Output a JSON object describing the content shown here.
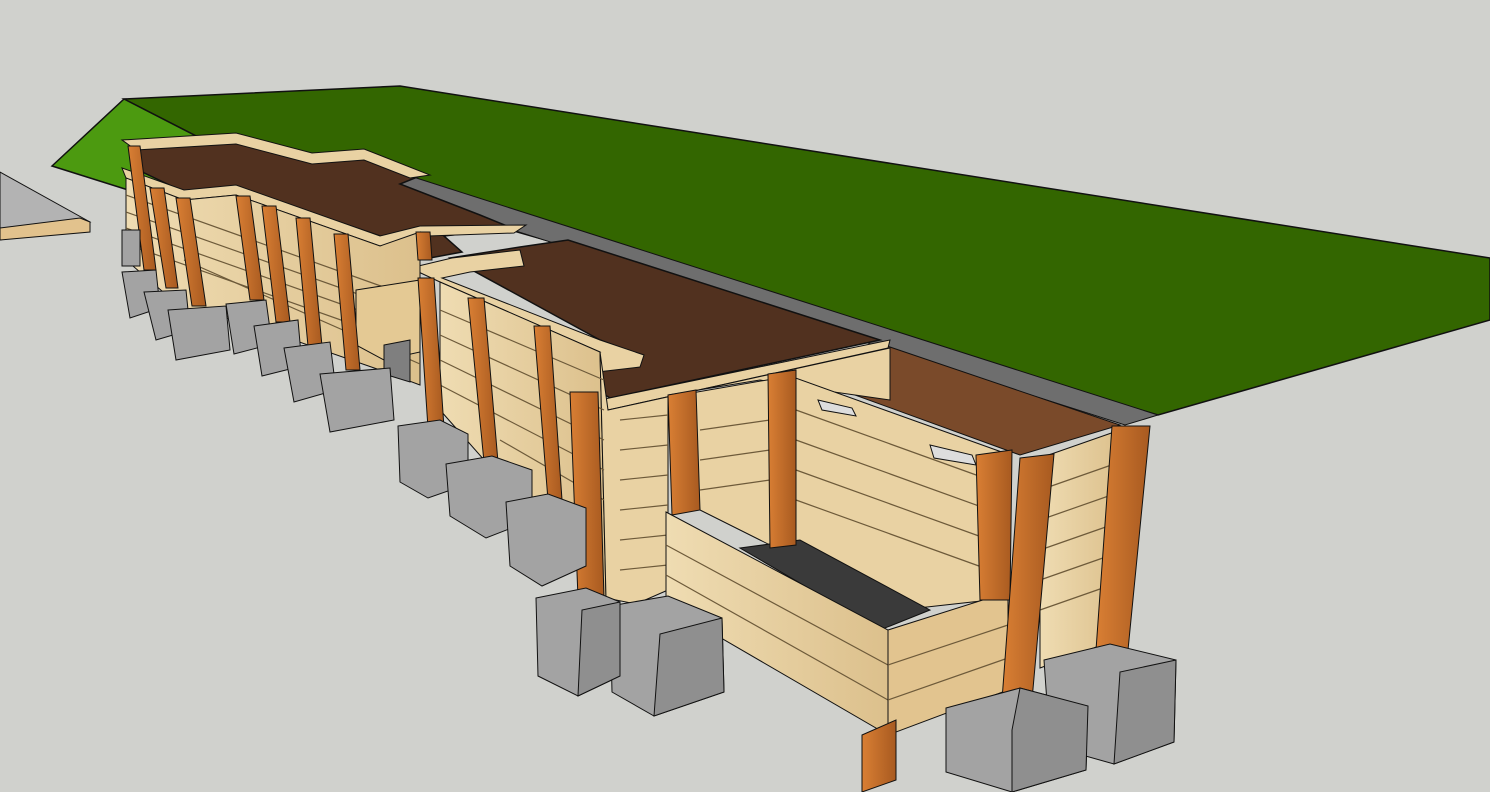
{
  "scene": {
    "subject": "raised-garden-bed-3d-model",
    "colors": {
      "background": "#d0d1cd",
      "lawn": "#336600",
      "lawn_lit": "#4c9a10",
      "soil": "#51311f",
      "soil_light": "#7a4a2a",
      "plank": "#e9d2a3",
      "plank_shade": "#d7bb85",
      "post": "#c26a2a",
      "post_dark": "#8f4a1a",
      "concrete": "#a3a3a3",
      "concrete_dark": "#7f7f7f",
      "paver": "#6e6e6e",
      "liner": "#3a3a3a",
      "edge": "#111111"
    }
  }
}
